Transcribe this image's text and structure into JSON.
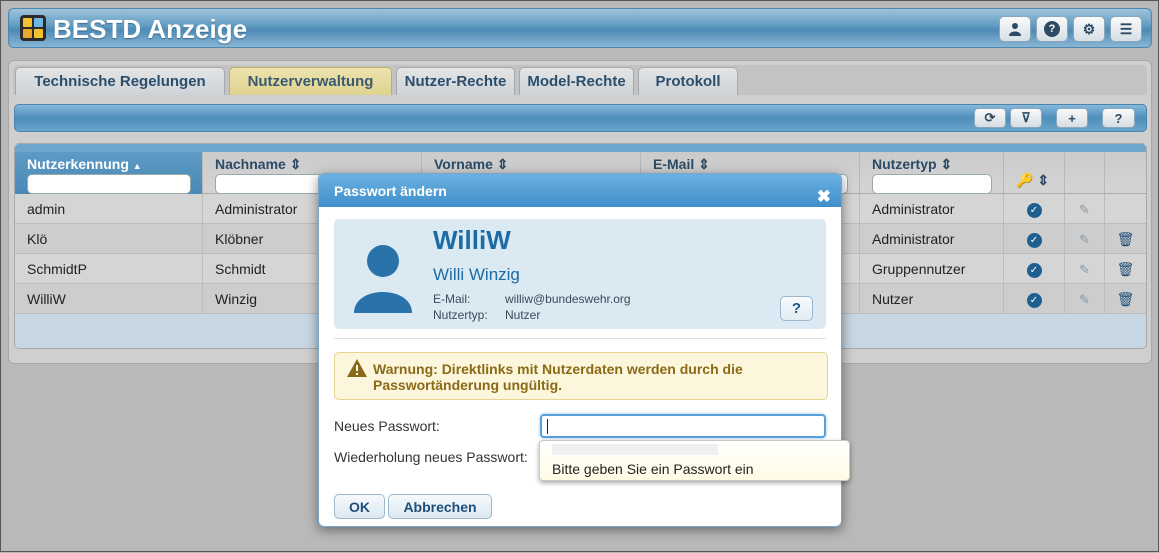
{
  "app": {
    "title": "BESTD Anzeige",
    "header_buttons": [
      {
        "icon": "user-icon",
        "glyph": "👤"
      },
      {
        "icon": "help-icon",
        "glyph": "?"
      },
      {
        "icon": "gear-icon",
        "glyph": "⚙"
      },
      {
        "icon": "menu-icon",
        "glyph": "☰"
      }
    ]
  },
  "tabs": [
    {
      "label": "Technische Regelungen",
      "active": false
    },
    {
      "label": "Nutzerverwaltung",
      "active": true
    },
    {
      "label": "Nutzer-Rechte",
      "active": false
    },
    {
      "label": "Model-Rechte",
      "active": false
    },
    {
      "label": "Protokoll",
      "active": false
    }
  ],
  "toolbar": {
    "buttons": [
      {
        "icon": "refresh-icon",
        "glyph": "⟳"
      },
      {
        "icon": "filter-clear-icon",
        "glyph": "⊽"
      },
      {
        "icon": "add-icon",
        "glyph": "+"
      },
      {
        "icon": "help-icon",
        "glyph": "?"
      }
    ]
  },
  "grid": {
    "columns": [
      {
        "label": "Nutzerkennung",
        "sort": "▲"
      },
      {
        "label": "Nachname",
        "sort": "⇕"
      },
      {
        "label": "Vorname",
        "sort": "⇕"
      },
      {
        "label": "E-Mail",
        "sort": "⇕"
      },
      {
        "label": "Nutzertyp",
        "sort": "⇕"
      },
      {
        "label": "",
        "sort": "⇕",
        "icon": "key-icon"
      }
    ],
    "rows": [
      {
        "login": "admin",
        "lastname": "Administrator",
        "type": "Administrator",
        "deletable": false
      },
      {
        "login": "Klö",
        "lastname": "Klöbner",
        "type": "Administrator",
        "deletable": true
      },
      {
        "login": "SchmidtP",
        "lastname": "Schmidt",
        "type": "Gruppennutzer",
        "deletable": true
      },
      {
        "login": "WilliW",
        "lastname": "Winzig",
        "type": "Nutzer",
        "deletable": true
      }
    ]
  },
  "dialog": {
    "title": "Passwort ändern",
    "close_glyph": "✖",
    "user": {
      "login": "WilliW",
      "fullname": "Willi Winzig",
      "email_label": "E-Mail:",
      "email": "williw@bundeswehr.org",
      "type_label": "Nutzertyp:",
      "type": "Nutzer",
      "help_glyph": "?"
    },
    "warning": "Warnung: Direktlinks mit Nutzerdaten werden durch die Passwortänderung ungültig.",
    "new_password_label": "Neues Passwort:",
    "repeat_password_label": "Wiederholung neues Passwort:",
    "new_password_value": "",
    "tooltip": "Bitte geben Sie ein Passwort ein",
    "ok_label": "OK",
    "cancel_label": "Abbrechen"
  }
}
